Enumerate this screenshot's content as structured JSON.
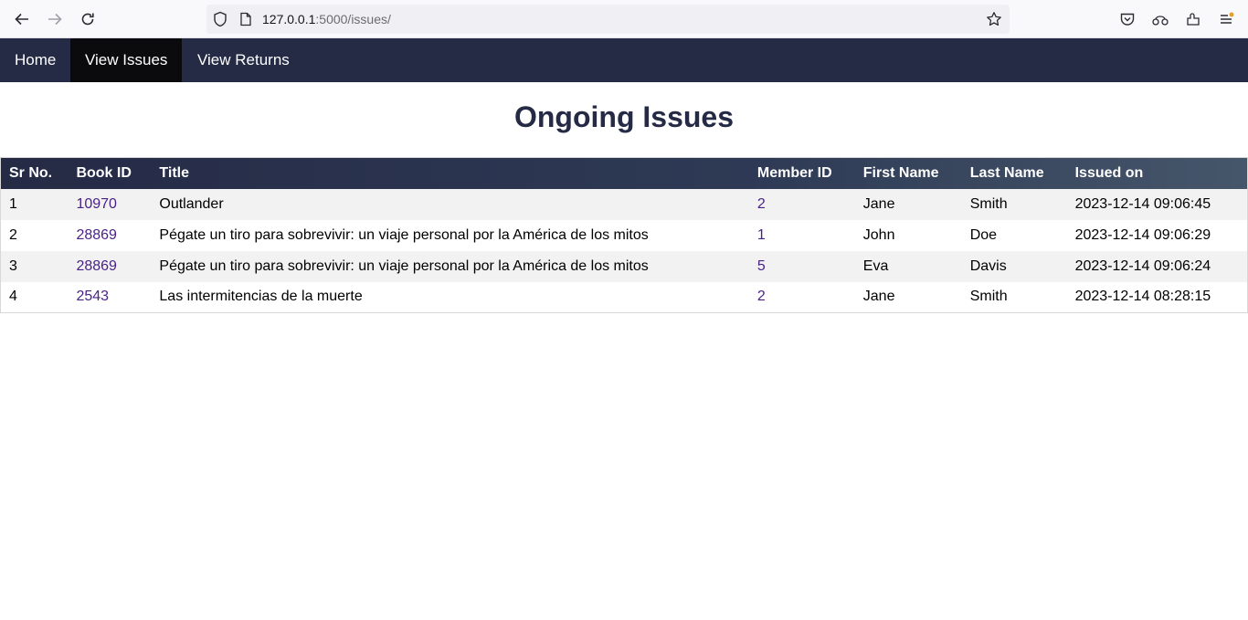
{
  "browser": {
    "url_host": "127.0.0.1",
    "url_path": ":5000/issues/",
    "icons": [
      "back-icon",
      "forward-icon",
      "reload-icon",
      "shield-icon",
      "page-icon",
      "star-icon",
      "pocket-icon",
      "sync-icon",
      "extensions-icon",
      "menu-icon"
    ]
  },
  "nav": {
    "home": "Home",
    "issues": "View Issues",
    "returns": "View Returns"
  },
  "page": {
    "title": "Ongoing Issues"
  },
  "table": {
    "headers": {
      "sr": "Sr No.",
      "book_id": "Book ID",
      "title": "Title",
      "member_id": "Member ID",
      "first_name": "First Name",
      "last_name": "Last Name",
      "issued_on": "Issued on"
    },
    "rows": [
      {
        "sr": "1",
        "book_id": "10970",
        "title": "Outlander",
        "member_id": "2",
        "first_name": "Jane",
        "last_name": "Smith",
        "issued_on": "2023-12-14 09:06:45"
      },
      {
        "sr": "2",
        "book_id": "28869",
        "title": "Pégate un tiro para sobrevivir: un viaje personal por la América de los mitos",
        "member_id": "1",
        "first_name": "John",
        "last_name": "Doe",
        "issued_on": "2023-12-14 09:06:29"
      },
      {
        "sr": "3",
        "book_id": "28869",
        "title": "Pégate un tiro para sobrevivir: un viaje personal por la América de los mitos",
        "member_id": "5",
        "first_name": "Eva",
        "last_name": "Davis",
        "issued_on": "2023-12-14 09:06:24"
      },
      {
        "sr": "4",
        "book_id": "2543",
        "title": "Las intermitencias de la muerte",
        "member_id": "2",
        "first_name": "Jane",
        "last_name": "Smith",
        "issued_on": "2023-12-14 08:28:15"
      }
    ]
  },
  "colors": {
    "nav_bg": "#252a45",
    "nav_active_bg": "#0b0b0e",
    "title_color": "#252a45",
    "link_color": "#4a2287",
    "row_alt": "#f2f2f2"
  }
}
